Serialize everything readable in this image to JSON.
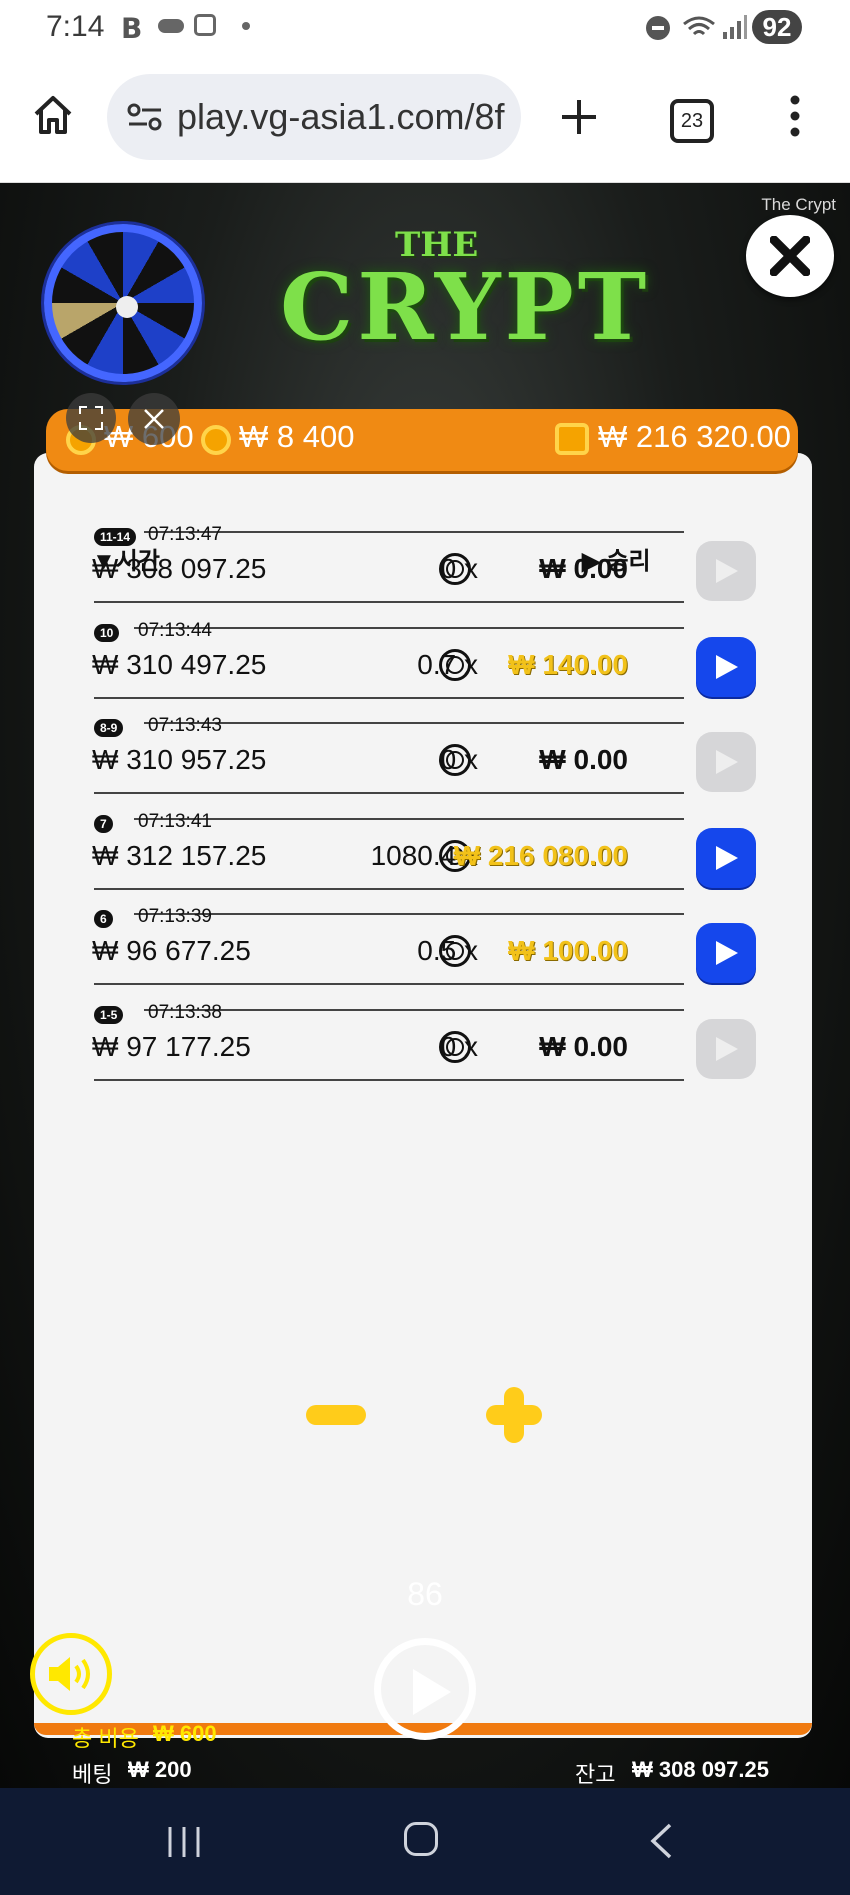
{
  "status_bar": {
    "time": "7:14",
    "battery": "92"
  },
  "browser": {
    "url": "play.vg-asia1.com/8f",
    "tab_count": "23"
  },
  "game": {
    "caption": "The Crypt",
    "logo_small": "THE",
    "logo_main": "CRYPT",
    "top_bar": {
      "bet_partial": "₩ 600",
      "coins_value": "₩ 8 400",
      "wallet_value": "₩ 216 320.00"
    },
    "table": {
      "col_time": "시간",
      "col_win": "승리",
      "rows": [
        {
          "badge": "11-14",
          "time": "07:13:47",
          "balance": "₩ 308 097.25",
          "multiplier": "0 x",
          "win": "₩ 0.00",
          "highlight": false
        },
        {
          "badge": "10",
          "time": "07:13:44",
          "balance": "₩ 310 497.25",
          "multiplier": "0.7 x",
          "win": "₩ 140.00",
          "highlight": true
        },
        {
          "badge": "8-9",
          "time": "07:13:43",
          "balance": "₩ 310 957.25",
          "multiplier": "0 x",
          "win": "₩ 0.00",
          "highlight": false
        },
        {
          "badge": "7",
          "time": "07:13:41",
          "balance": "₩ 312 157.25",
          "multiplier": "1080.4 x",
          "win": "₩ 216 080.00",
          "highlight": true
        },
        {
          "badge": "6",
          "time": "07:13:39",
          "balance": "₩ 96 677.25",
          "multiplier": "0.5 x",
          "win": "₩ 100.00",
          "highlight": true
        },
        {
          "badge": "1-5",
          "time": "07:13:38",
          "balance": "₩ 97 177.25",
          "multiplier": "0 x",
          "win": "₩ 0.00",
          "highlight": false
        }
      ]
    },
    "controls": {
      "count": "86",
      "total_cost_label": "총 비용",
      "total_cost_value": "₩ 600",
      "bet_label": "베팅",
      "bet_value": "₩ 200",
      "balance_label": "잔고",
      "balance_value": "₩ 308 097.25"
    }
  },
  "colors": {
    "accent_orange": "#f08a13",
    "play_blue": "#1547ec",
    "win_gold": "#f2c21a",
    "logo_green": "#7ee04a",
    "control_yellow": "#ffcc1a"
  }
}
